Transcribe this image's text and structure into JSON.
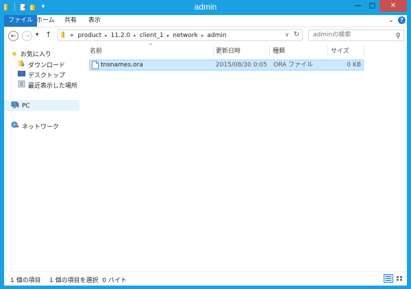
{
  "window": {
    "title": "admin",
    "accent": "#1BA1E2",
    "close_color": "#C75050"
  },
  "quick_access": {
    "dropdown_glyph": "▾"
  },
  "title_buttons": {
    "minimize": "—",
    "maximize": "□",
    "close": "✕"
  },
  "ribbon": {
    "tabs": [
      {
        "label": "ファイル",
        "active": true
      },
      {
        "label": "ホーム"
      },
      {
        "label": "共有"
      },
      {
        "label": "表示"
      }
    ],
    "expand_glyph": "⌄",
    "help_glyph": "?"
  },
  "nav": {
    "back_glyph": "←",
    "forward_glyph": "→",
    "recent_glyph": "▾",
    "up_glyph": "↑",
    "breadcrumb_prefix": "«",
    "breadcrumb_sep": "▸",
    "breadcrumbs": [
      "product",
      "11.2.0",
      "client_1",
      "network",
      "admin"
    ],
    "address_dropdown": "∨",
    "refresh_glyph": "↻",
    "search_placeholder": "adminの検索",
    "search_glyph": "⚲"
  },
  "sidebar": {
    "favorites": {
      "label": "お気に入り",
      "icon": "star-icon"
    },
    "favorite_items": [
      {
        "label": "ダウンロード",
        "icon": "download-folder-icon"
      },
      {
        "label": "デスクトップ",
        "icon": "desktop-icon"
      },
      {
        "label": "最近表示した場所",
        "icon": "recent-places-icon"
      }
    ],
    "pc": {
      "label": "PC",
      "icon": "computer-icon"
    },
    "network": {
      "label": "ネットワーク",
      "icon": "network-icon"
    }
  },
  "columns": {
    "name": "名前",
    "modified": "更新日時",
    "type": "種類",
    "size": "サイズ",
    "sort_glyph": "^"
  },
  "files": [
    {
      "name": "tnsnames.ora",
      "modified": "2015/08/30 0:05",
      "type": "ORA ファイル",
      "size": "0 KB"
    }
  ],
  "status": {
    "item_count": "1 個の項目",
    "selection": "1 個の項目を選択  0 バイト"
  }
}
